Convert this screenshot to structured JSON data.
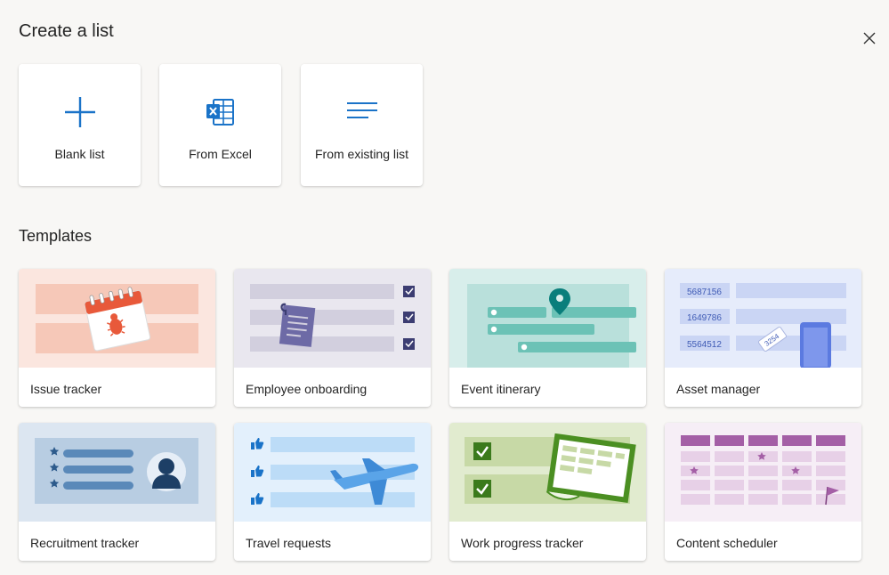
{
  "dialog": {
    "title": "Create a list",
    "close_icon": "close-icon"
  },
  "create_options": [
    {
      "label": "Blank list",
      "icon": "plus-icon"
    },
    {
      "label": "From Excel",
      "icon": "excel-icon"
    },
    {
      "label": "From existing list",
      "icon": "list-lines-icon"
    }
  ],
  "templates_heading": "Templates",
  "templates": [
    {
      "label": "Issue tracker",
      "icon": "calendar-bug-icon"
    },
    {
      "label": "Employee onboarding",
      "icon": "clipboard-checklist-icon"
    },
    {
      "label": "Event itinerary",
      "icon": "map-pin-icon"
    },
    {
      "label": "Asset manager",
      "icon": "asset-tag-icon",
      "art_text": [
        "5687156",
        "1649786",
        "5564512",
        "3254"
      ]
    },
    {
      "label": "Recruitment tracker",
      "icon": "candidate-profile-icon"
    },
    {
      "label": "Travel requests",
      "icon": "airplane-icon"
    },
    {
      "label": "Work progress tracker",
      "icon": "progress-board-icon"
    },
    {
      "label": "Content scheduler",
      "icon": "calendar-grid-icon"
    }
  ],
  "colors": {
    "accent": "#0f6cbd",
    "excel_blue": "#1a73c8",
    "background": "#f8f7f5"
  }
}
